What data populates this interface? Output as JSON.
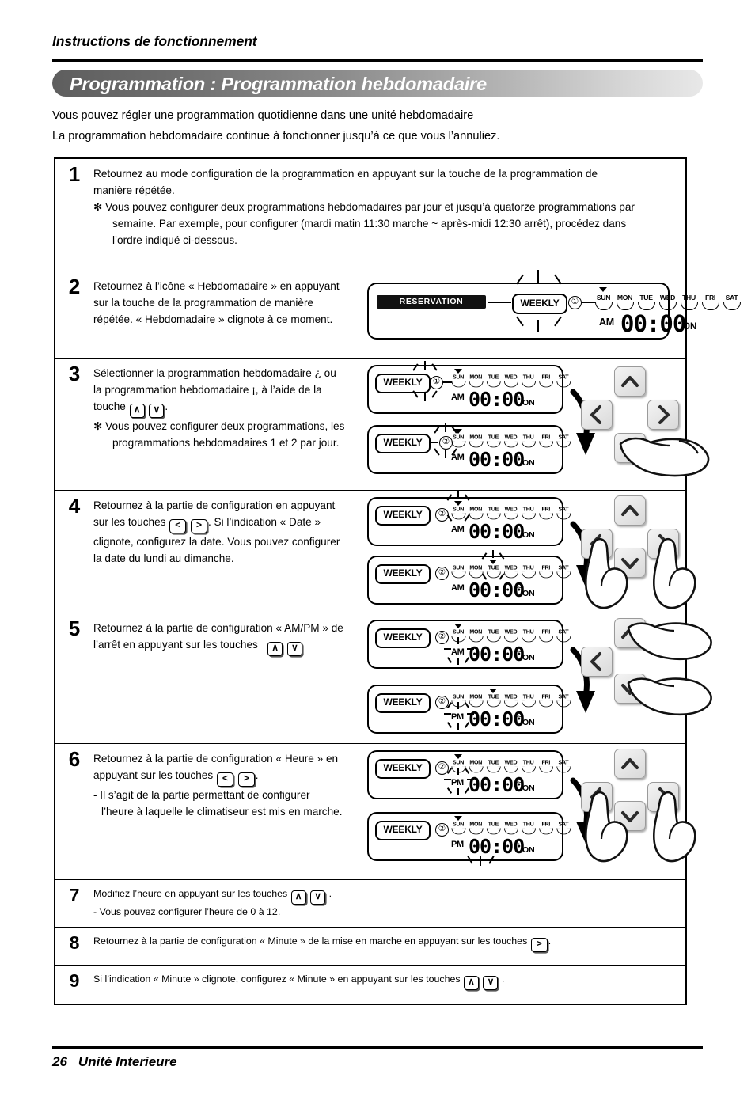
{
  "header": {
    "title": "Instructions de fonctionnement",
    "banner": "Programmation : Programmation hebdomadaire",
    "intro_line1": "Vous pouvez régler une programmation quotidienne dans une unité hebdomadaire",
    "intro_line2": "La programmation hebdomadaire continue à fonctionner jusqu’à ce que vous l’annuliez."
  },
  "steps": {
    "s1": {
      "num": "1",
      "line1": "Retournez au mode configuration de la programmation en appuyant sur la touche de la programmation de",
      "line2": "manière répétée.",
      "note1": "✻ Vous pouvez configurer deux programmations hebdomadaires par jour et jusqu’à quatorze programmations par",
      "note2": "semaine. Par exemple, pour configurer (mardi matin 11:30 marche ~ après-midi 12:30 arrêt), procédez dans",
      "note3": "l’ordre indiqué ci-dessous."
    },
    "s2": {
      "num": "2",
      "line1": "Retournez à l’icône « Hebdomadaire » en appuyant",
      "line2": "sur la touche de la programmation de manière",
      "line3": "répétée. « Hebdomadaire » clignote à ce moment."
    },
    "s3": {
      "num": "3",
      "line1": "Sélectionner la programmation hebdomadaire ¿ ou",
      "line2": "la programmation hebdomadaire ¡, à l’aide de la",
      "line3_pre": "touche",
      "line3_post": ".",
      "note1": "✻ Vous pouvez configurer deux programmations, les",
      "note2": "programmations hebdomadaires 1 et 2 par jour."
    },
    "s4": {
      "num": "4",
      "line1": "Retournez à la partie de configuration en appuyant",
      "line2_pre": "sur les touches",
      "line2_post": ". Si l’indication « Date »",
      "line3": "clignote, configurez la date. Vous pouvez configurer",
      "line4": "la date du lundi au dimanche."
    },
    "s5": {
      "num": "5",
      "line1": "Retournez à la partie de configuration « AM/PM » de",
      "line2_pre": "l’arrêt en appuyant sur les touches"
    },
    "s6": {
      "num": "6",
      "line1": "Retournez à la partie de configuration « Heure » en",
      "line2_pre": "appuyant sur les touches",
      "line2_post": ".",
      "line3": "- Il s’agit de la partie permettant de configurer",
      "line4": "l’heure à laquelle le climatiseur est mis en marche."
    },
    "s7": {
      "num": "7",
      "line1_pre": "Modifiez l’heure en appuyant sur les touches",
      "line1_post": ".",
      "line2": "- Vous pouvez configurer l’heure de 0 à 12."
    },
    "s8": {
      "num": "8",
      "line1_pre": "Retournez à la partie de configuration « Minute » de la mise en marche en appuyant sur les touches",
      "line1_post": "."
    },
    "s9": {
      "num": "9",
      "line1_pre": "Si l’indication « Minute » clignote, configurez « Minute » en appuyant sur les touches",
      "line1_post": "."
    }
  },
  "lcd": {
    "reservation": "RESERVATION",
    "weekly": "WEEKLY",
    "prog1": "①",
    "prog2": "②",
    "days": [
      "SUN",
      "MON",
      "TUE",
      "WED",
      "THU",
      "FRI",
      "SAT"
    ],
    "am": "AM",
    "pm": "PM",
    "time": "00:00",
    "on": "ON",
    "tilde": "~"
  },
  "panels": {
    "p2": {
      "marker_day": "SUN",
      "prog": "①",
      "meridiem": "AM"
    },
    "p3a": {
      "marker_day": "SUN",
      "prog": "①",
      "meridiem": "AM"
    },
    "p3b": {
      "marker_day": "SUN",
      "prog": "②",
      "meridiem": "AM"
    },
    "p4a": {
      "marker_day": "SUN",
      "prog": "②",
      "meridiem": "AM"
    },
    "p4b": {
      "marker_day": "TUE",
      "prog": "②",
      "meridiem": "AM"
    },
    "p5a": {
      "marker_day": "SUN",
      "prog": "②",
      "meridiem": "AM"
    },
    "p5b": {
      "marker_day": "TUE",
      "prog": "②",
      "meridiem": "PM"
    },
    "p6a": {
      "marker_day": "SUN",
      "prog": "②",
      "meridiem": "PM"
    },
    "p6b": {
      "marker_day": "SUN",
      "prog": "②",
      "meridiem": "PM"
    }
  },
  "keys": {
    "up": "∧",
    "down": "∨",
    "left": "<",
    "right": ">"
  },
  "footer": {
    "page": "26",
    "label": "Unité Interieure"
  }
}
